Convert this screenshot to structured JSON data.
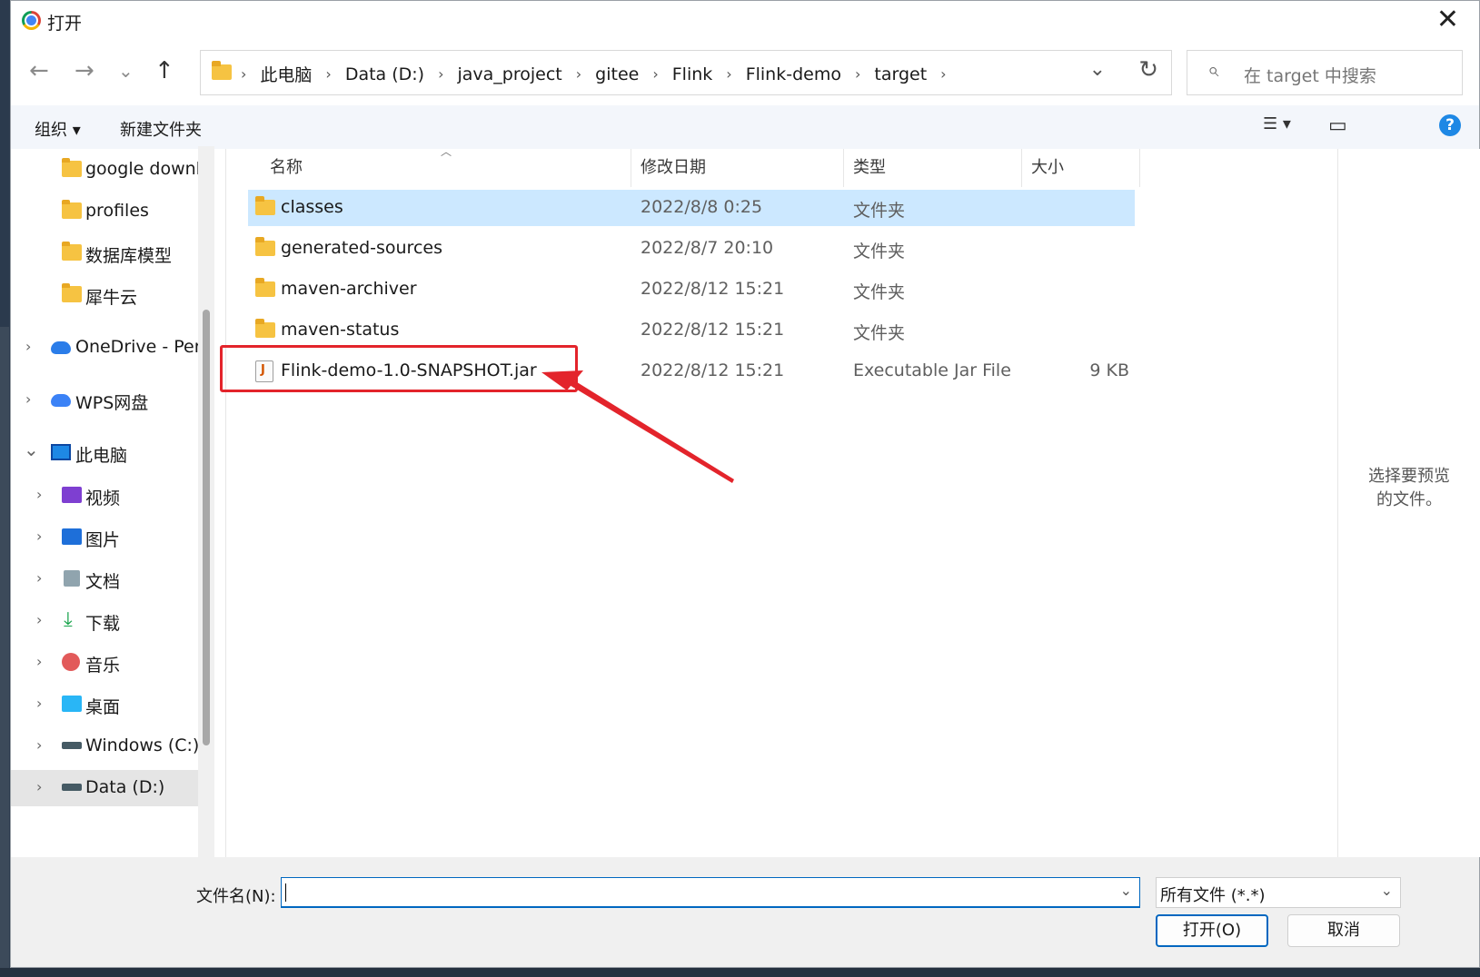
{
  "window": {
    "title": "打开"
  },
  "nav": {
    "back": "←",
    "forward": "→",
    "recent": "⌄",
    "up": "↑"
  },
  "address": {
    "crumbs": [
      "此电脑",
      "Data (D:)",
      "java_project",
      "gitee",
      "Flink",
      "Flink-demo",
      "target"
    ],
    "separator": "›",
    "dropdown": "⌄",
    "refresh": "↻"
  },
  "search": {
    "placeholder": "在 target 中搜索",
    "icon": "⌕"
  },
  "toolbar": {
    "organize": "组织 ▾",
    "new_folder": "新建文件夹",
    "view_icon": "☰ ▾",
    "pane_icon": "▭",
    "help": "?"
  },
  "sidebar": {
    "items": [
      {
        "label": "google downlo",
        "icon": "folder",
        "chevron": ""
      },
      {
        "label": "profiles",
        "icon": "folder",
        "chevron": ""
      },
      {
        "label": "数据库模型",
        "icon": "folder",
        "chevron": ""
      },
      {
        "label": "犀牛云",
        "icon": "folder",
        "chevron": ""
      },
      {
        "label": "OneDrive - Pers",
        "icon": "cloud",
        "chevron": "›"
      },
      {
        "label": "WPS网盘",
        "icon": "wps-cloud",
        "chevron": "›"
      },
      {
        "label": "此电脑",
        "icon": "computer",
        "chevron": "⌄"
      },
      {
        "label": "视频",
        "icon": "video",
        "chevron": "›"
      },
      {
        "label": "图片",
        "icon": "pictures",
        "chevron": "›"
      },
      {
        "label": "文档",
        "icon": "documents",
        "chevron": "›"
      },
      {
        "label": "下载",
        "icon": "download",
        "chevron": "›"
      },
      {
        "label": "音乐",
        "icon": "music",
        "chevron": "›"
      },
      {
        "label": "桌面",
        "icon": "desktop",
        "chevron": "›"
      },
      {
        "label": "Windows (C:)",
        "icon": "drive",
        "chevron": "›"
      },
      {
        "label": "Data (D:)",
        "icon": "drive",
        "chevron": "›"
      }
    ]
  },
  "columns": {
    "name": "名称",
    "modified": "修改日期",
    "type": "类型",
    "size": "大小"
  },
  "files": [
    {
      "name": "classes",
      "modified": "2022/8/8 0:25",
      "type": "文件夹",
      "size": ""
    },
    {
      "name": "generated-sources",
      "modified": "2022/8/7 20:10",
      "type": "文件夹",
      "size": ""
    },
    {
      "name": "maven-archiver",
      "modified": "2022/8/12 15:21",
      "type": "文件夹",
      "size": ""
    },
    {
      "name": "maven-status",
      "modified": "2022/8/12 15:21",
      "type": "文件夹",
      "size": ""
    },
    {
      "name": "Flink-demo-1.0-SNAPSHOT.jar",
      "modified": "2022/8/12 15:21",
      "type": "Executable Jar File",
      "size": "9 KB"
    }
  ],
  "preview": {
    "line1": "选择要预览",
    "line2": "的文件。"
  },
  "bottom": {
    "filename_label": "文件名(N):",
    "filename_value": "",
    "filetype": "所有文件 (*.*)",
    "open_button": "打开(O)",
    "cancel_button": "取消"
  },
  "colors": {
    "accent": "#0067c0",
    "annotation": "#e3242b",
    "selected_row": "#cce8ff"
  }
}
